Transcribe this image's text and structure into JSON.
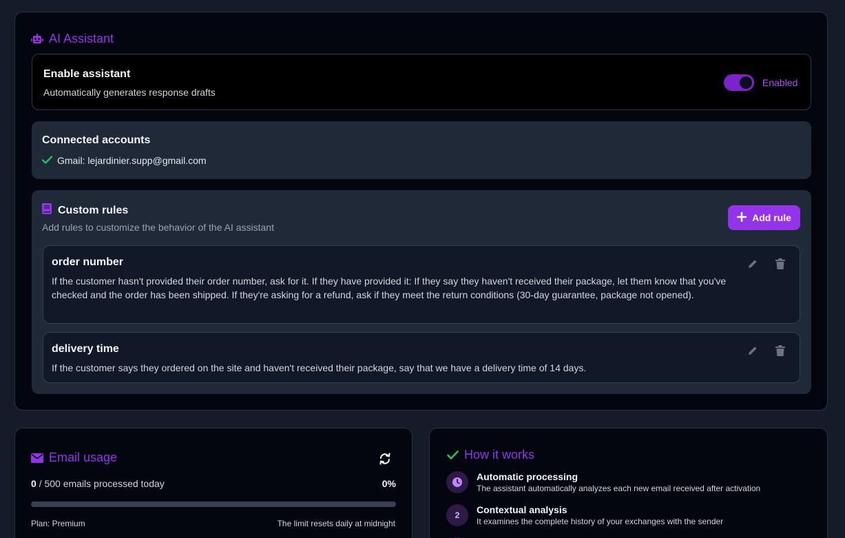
{
  "assistant": {
    "title": "AI Assistant",
    "enable": {
      "heading": "Enable assistant",
      "description": "Automatically generates response drafts",
      "state_label": "Enabled",
      "enabled": true
    },
    "accounts": {
      "heading": "Connected accounts",
      "items": [
        {
          "label": "Gmail: lejardinier.supp@gmail.com",
          "icon": "check-icon"
        }
      ]
    },
    "rules": {
      "heading": "Custom rules",
      "description": "Add rules to customize the behavior of the AI assistant",
      "add_label": "Add rule",
      "items": [
        {
          "title": "order number",
          "body": "If the customer hasn't provided their order number, ask for it. If they have provided it: If they say they haven't received their package, let them know that you've checked and the order has been shipped. If they're asking for a refund, ask if they meet the return conditions (30-day guarantee, package not opened)."
        },
        {
          "title": "delivery time",
          "body": "If the customer says they ordered on the site and haven't received their package, say that we have a delivery time of 14 days."
        }
      ]
    }
  },
  "usage": {
    "title": "Email usage",
    "used": "0",
    "text_rest": " / 500 emails processed today",
    "percent_label": "0%",
    "progress_fraction": 0,
    "plan": "Plan: Premium",
    "reset_note": "The limit resets daily at midnight"
  },
  "how": {
    "title": "How it works",
    "steps": [
      {
        "badge_icon": "clock-icon",
        "title": "Automatic processing",
        "description": "The assistant automatically analyzes each new email received after activation"
      },
      {
        "number": "2",
        "title": "Contextual analysis",
        "description": "It examines the complete history of your exchanges with the sender"
      }
    ]
  },
  "colors": {
    "accent": "#9333ea",
    "success": "#22c55e",
    "panel_bg": "#03060f",
    "card_bg": "#1f2937"
  }
}
